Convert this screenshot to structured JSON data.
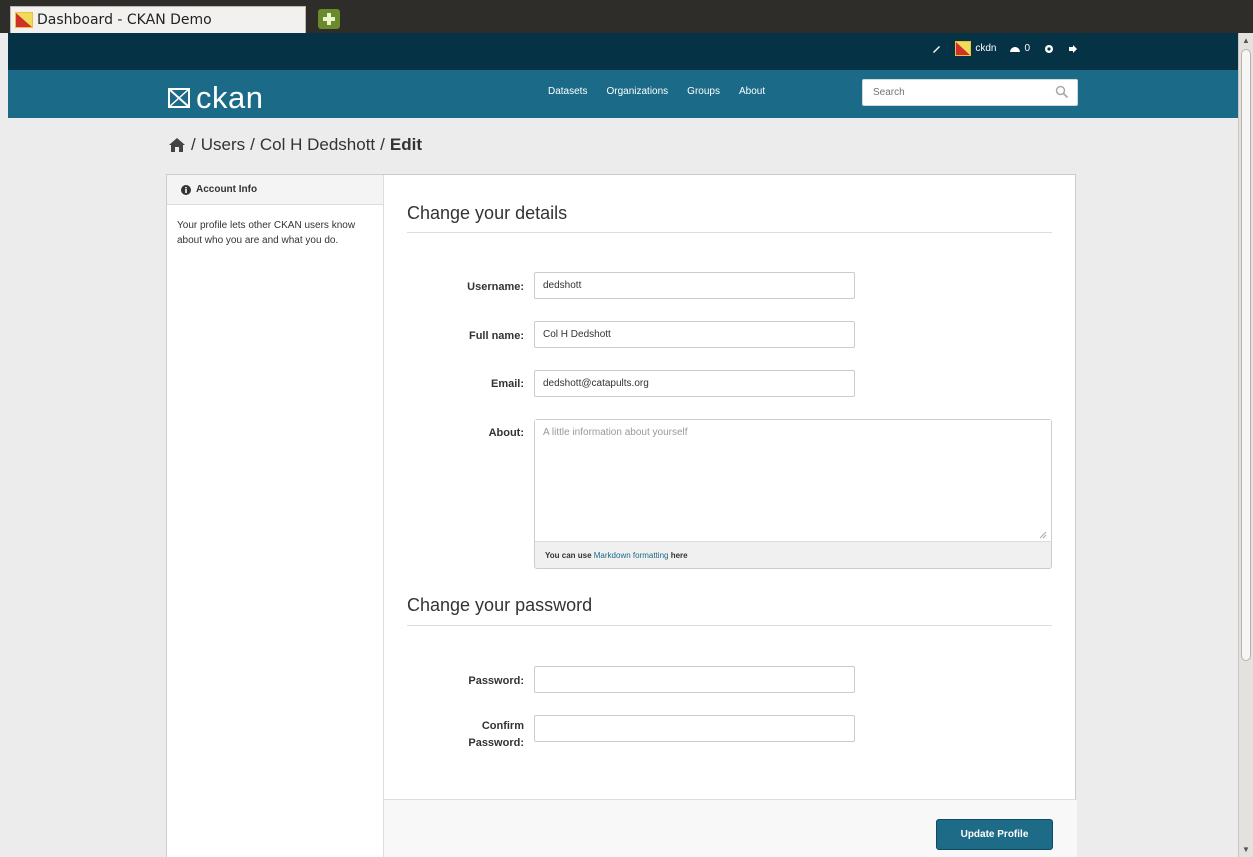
{
  "browser": {
    "tab_title": "Dashboard - CKAN Demo"
  },
  "account": {
    "username": "ckdn",
    "notification_count": "0"
  },
  "masthead": {
    "logo_text": "ckan",
    "nav": [
      "Datasets",
      "Organizations",
      "Groups",
      "About"
    ],
    "search_placeholder": "Search"
  },
  "breadcrumb": {
    "section": "Users",
    "user": "Col H Dedshott",
    "current": "Edit",
    "separator": "/"
  },
  "sidebar": {
    "title": "Account Info",
    "text": "Your profile lets other CKAN users know about who you are and what you do."
  },
  "details": {
    "heading": "Change your details",
    "username_label": "Username:",
    "username_value": "dedshott",
    "fullname_label": "Full name:",
    "fullname_value": "Col H Dedshott",
    "email_label": "Email:",
    "email_value": "dedshott@catapults.org",
    "about_label": "About:",
    "about_placeholder": "A little information about yourself",
    "hint_prefix": "You can use",
    "hint_link": "Markdown formatting",
    "hint_suffix": "here"
  },
  "password": {
    "heading": "Change your password",
    "password_label": "Password:",
    "confirm_label_1": "Confirm",
    "confirm_label_2": "Password:"
  },
  "actions": {
    "submit_label": "Update Profile"
  },
  "colors": {
    "masthead": "#1b6a88",
    "account_bar": "#063246",
    "button": "#1e6b87"
  }
}
